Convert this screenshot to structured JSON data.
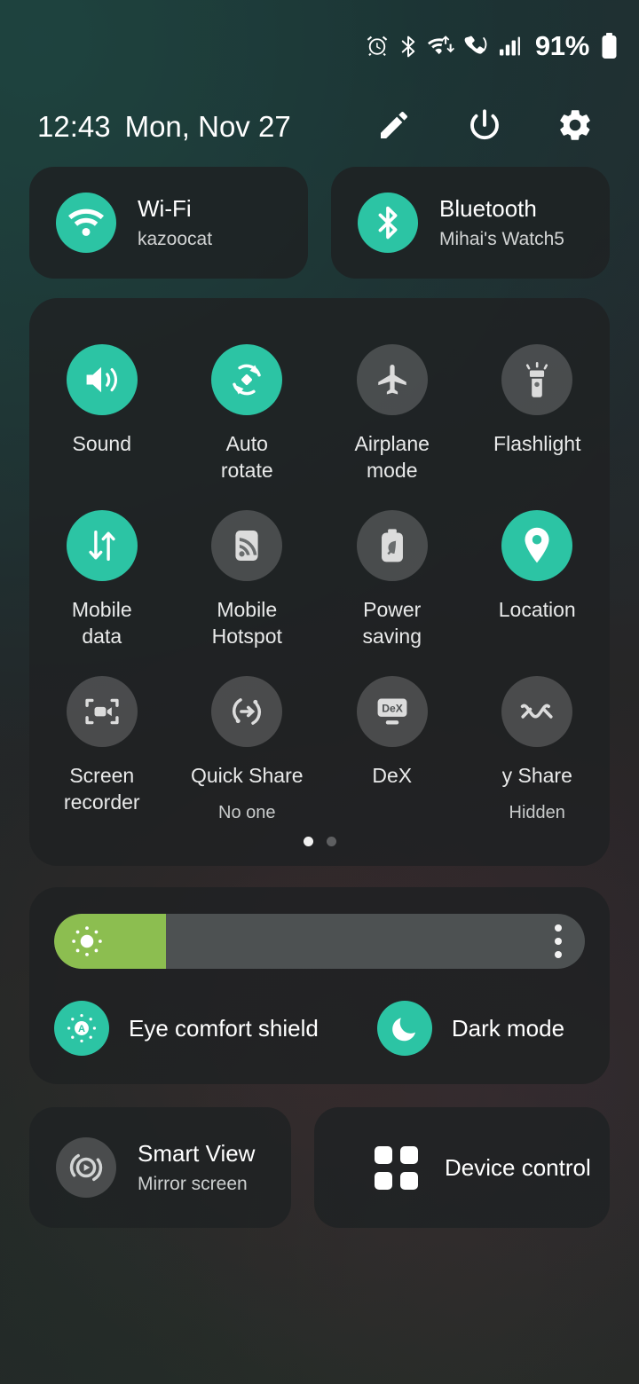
{
  "status_bar": {
    "icons": [
      "alarm-icon",
      "bluetooth-icon",
      "wifi-icon",
      "call-vibrate-icon",
      "signal-bars-icon"
    ],
    "battery_percent": "91%",
    "battery_icon": "battery-full-icon"
  },
  "header": {
    "time": "12:43",
    "date": "Mon, Nov 27",
    "actions": [
      {
        "name": "edit-button",
        "icon": "pencil-icon"
      },
      {
        "name": "power-button",
        "icon": "power-icon"
      },
      {
        "name": "settings-button",
        "icon": "gear-icon"
      }
    ]
  },
  "connectivity": [
    {
      "title": "Wi-Fi",
      "subtitle": "kazoocat",
      "icon": "wifi-icon",
      "active": true
    },
    {
      "title": "Bluetooth",
      "subtitle": "Mihai's Watch5",
      "icon": "bluetooth-icon",
      "active": true
    }
  ],
  "quick_settings": {
    "tiles": [
      {
        "label": "Sound",
        "sub": "",
        "icon": "volume-icon",
        "active": true
      },
      {
        "label": "Auto\nrotate",
        "sub": "",
        "icon": "auto-rotate-icon",
        "active": true
      },
      {
        "label": "Airplane\nmode",
        "sub": "",
        "icon": "airplane-icon",
        "active": false
      },
      {
        "label": "Flashlight",
        "sub": "",
        "icon": "flashlight-icon",
        "active": false
      },
      {
        "label": "Mobile\ndata",
        "sub": "",
        "icon": "mobile-data-icon",
        "active": true
      },
      {
        "label": "Mobile\nHotspot",
        "sub": "",
        "icon": "hotspot-icon",
        "active": false
      },
      {
        "label": "Power\nsaving",
        "sub": "",
        "icon": "power-saving-icon",
        "active": false
      },
      {
        "label": "Location",
        "sub": "",
        "icon": "location-pin-icon",
        "active": true
      },
      {
        "label": "Screen\nrecorder",
        "sub": "",
        "icon": "screen-recorder-icon",
        "active": false
      },
      {
        "label": "Quick Share",
        "sub": "No one",
        "icon": "quick-share-icon",
        "active": false
      },
      {
        "label": "DeX",
        "sub": "",
        "icon": "dex-icon",
        "active": false
      },
      {
        "label": "y Share",
        "sub": "Hidden",
        "icon": "music-share-icon",
        "active": false
      }
    ],
    "pages": {
      "count": 2,
      "current": 1
    }
  },
  "brightness": {
    "level_percent": 21,
    "slider_icon": "brightness-sun-icon",
    "menu_icon": "more-vertical-icon",
    "toggles": [
      {
        "label": "Eye comfort shield",
        "icon": "eye-comfort-icon",
        "active": true
      },
      {
        "label": "Dark mode",
        "icon": "moon-icon",
        "active": true
      }
    ]
  },
  "bottom_tiles": [
    {
      "title": "Smart View",
      "subtitle": "Mirror screen",
      "icon": "smart-view-icon"
    },
    {
      "title": "Device control",
      "subtitle": "",
      "icon": "device-control-grid-icon"
    }
  ],
  "colors": {
    "accent_active": "#2cc4a4",
    "inactive_circle": "#4a4d4e",
    "brightness_fill": "#8cbe50",
    "panel_bg": "#1f2223"
  }
}
